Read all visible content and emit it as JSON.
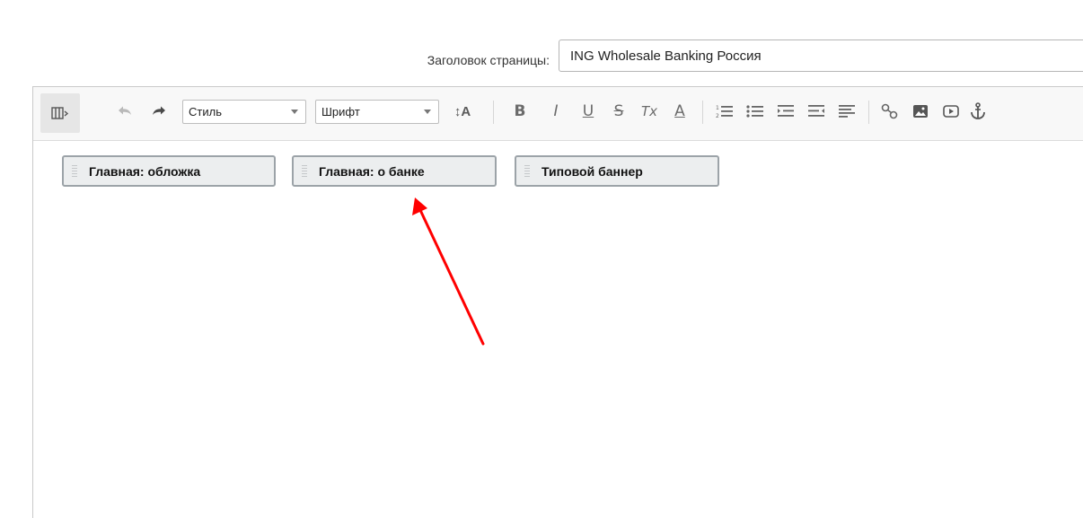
{
  "title_row": {
    "label": "Заголовок страницы:",
    "value": "ING Wholesale Banking Россия"
  },
  "toolbar": {
    "source_icon": "source-toggle-icon",
    "style_combo": {
      "value": "Стиль"
    },
    "font_combo": {
      "value": "Шрифт"
    },
    "font_size_label": "↕A",
    "bold_label": "B",
    "italic_label": "I",
    "underline_label": "U",
    "strike_label": "S",
    "clear_format_label": "Tx",
    "text_color_label": "A"
  },
  "blocks": [
    {
      "label": "Главная: обложка"
    },
    {
      "label": "Главная: о банке"
    },
    {
      "label": "Типовой баннер"
    }
  ],
  "annotation": {
    "color": "#ff0000"
  }
}
